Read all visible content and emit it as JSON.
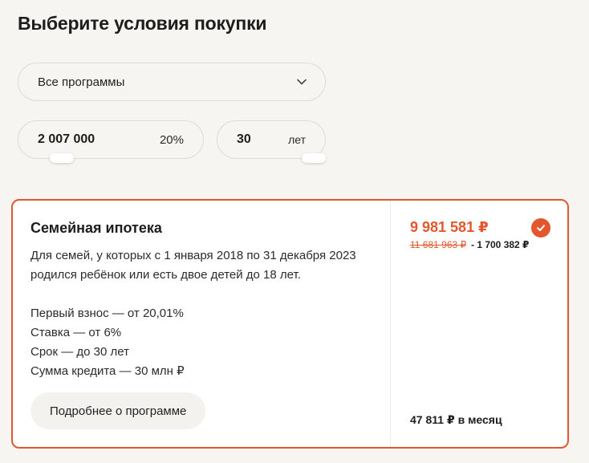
{
  "page": {
    "title": "Выберите условия покупки"
  },
  "program_select": {
    "value": "Все программы",
    "icon": "chevron-down-icon"
  },
  "price_field": {
    "value": "2 007 000",
    "percent": "20%"
  },
  "term_field": {
    "value": "30",
    "unit": "лет"
  },
  "offer": {
    "title": "Семейная ипотека",
    "description": "Для семей, у которых с 1 января 2018 по 31 декабря 2023 родился ребёнок или есть двое детей до 18 лет.",
    "features": [
      "Первый взнос — от 20,01%",
      "Ставка — от 6%",
      "Срок — до 30 лет",
      "Сумма кредита — 30 млн ₽"
    ],
    "details_button": "Подробнее о программе",
    "price_new": "9 981 581 ₽",
    "price_old": "11 681 963 ₽",
    "discount": "- 1 700 382 ₽",
    "monthly": "47 811 ₽ в месяц",
    "selected": true
  },
  "colors": {
    "accent": "#e4572e",
    "background": "#f6f5f1",
    "card": "#ffffff"
  }
}
